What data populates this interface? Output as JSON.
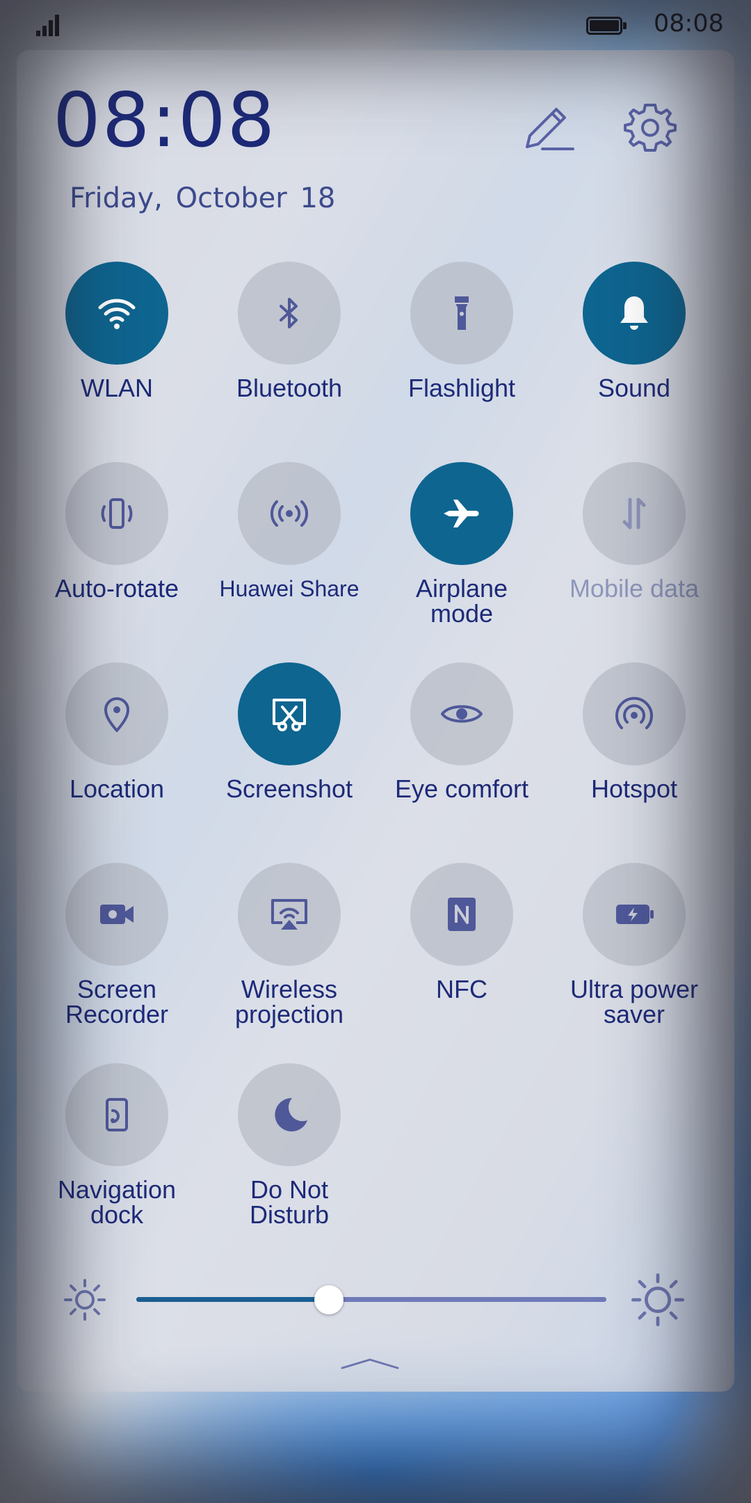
{
  "status_bar": {
    "time": "08:08",
    "signal_bars": 4,
    "battery_level": 1.0
  },
  "header": {
    "clock": "08:08",
    "date": "Friday,  October  18"
  },
  "header_actions": {
    "edit_icon": "pencil-icon",
    "settings_icon": "gear-icon"
  },
  "colors": {
    "tile_on": "#0e6590",
    "tile_off": "#b2b6c0",
    "text": "#1d2a78",
    "disabled_text": "#8f97bb"
  },
  "tiles": [
    {
      "label": "WLAN",
      "icon": "wifi-icon",
      "on": true
    },
    {
      "label": "Bluetooth",
      "icon": "bluetooth-icon",
      "on": false
    },
    {
      "label": "Flashlight",
      "icon": "flashlight-icon",
      "on": false
    },
    {
      "label": "Sound",
      "icon": "bell-icon",
      "on": true
    },
    {
      "label": "Auto-rotate",
      "icon": "rotate-icon",
      "on": false
    },
    {
      "label": "Huawei Share",
      "icon": "share-icon",
      "on": false
    },
    {
      "label": "Airplane\nmode",
      "icon": "airplane-icon",
      "on": true
    },
    {
      "label": "Mobile data",
      "icon": "mobile-data-icon",
      "on": false,
      "disabled": true
    },
    {
      "label": "Location",
      "icon": "location-pin-icon",
      "on": false
    },
    {
      "label": "Screenshot",
      "icon": "screenshot-icon",
      "on": true
    },
    {
      "label": "Eye comfort",
      "icon": "eye-icon",
      "on": false
    },
    {
      "label": "Hotspot",
      "icon": "hotspot-icon",
      "on": false
    },
    {
      "label": "Screen\nRecorder",
      "icon": "video-camera-icon",
      "on": false
    },
    {
      "label": "Wireless\nprojection",
      "icon": "projection-icon",
      "on": false
    },
    {
      "label": "NFC",
      "icon": "nfc-icon",
      "on": false
    },
    {
      "label": "Ultra power\nsaver",
      "icon": "battery-bolt-icon",
      "on": false
    },
    {
      "label": "Navigation\ndock",
      "icon": "navigation-dock-icon",
      "on": false
    },
    {
      "label": "Do Not\nDisturb",
      "icon": "moon-icon",
      "on": false
    }
  ],
  "brightness": {
    "level": 0.41,
    "low_icon": "sun-small-icon",
    "high_icon": "sun-large-icon"
  },
  "expand_handle_icon": "chevron-up-icon"
}
